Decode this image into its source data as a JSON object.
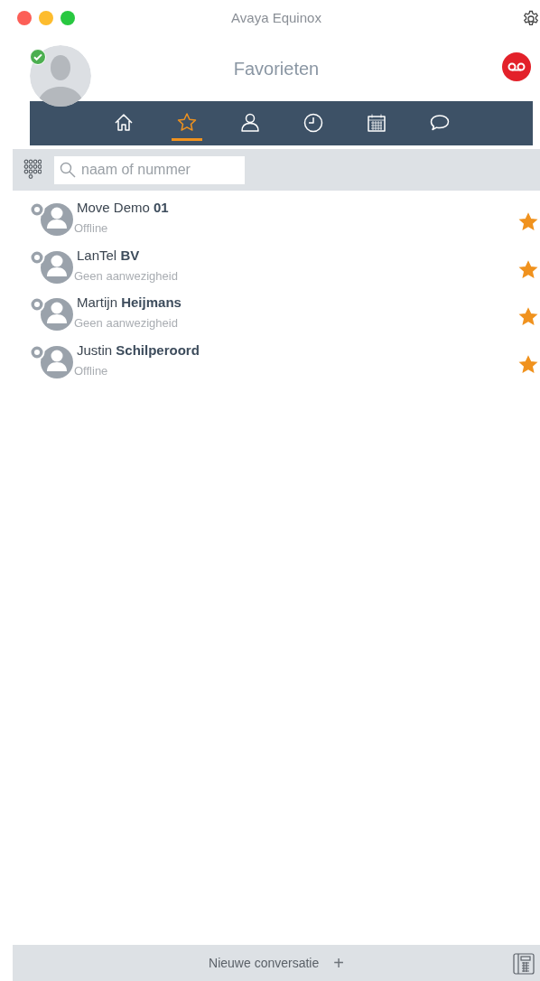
{
  "window": {
    "title": "Avaya Equinox"
  },
  "user": {
    "available": true
  },
  "header": {
    "title": "Favorieten",
    "voicemail": true
  },
  "tabs": [
    {
      "kind": "home",
      "selected": false
    },
    {
      "kind": "favorites",
      "selected": true
    },
    {
      "kind": "contacts",
      "selected": false
    },
    {
      "kind": "history",
      "selected": false
    },
    {
      "kind": "calendar",
      "selected": false
    },
    {
      "kind": "messages",
      "selected": false
    }
  ],
  "search": {
    "placeholder": "naam of nummer"
  },
  "contacts": [
    {
      "name": "Move Demo **01**",
      "status": "Offline",
      "favorite": true
    },
    {
      "name": "LanTel **BV**",
      "status": "Geen aanwezigheid",
      "favorite": true
    },
    {
      "name": "Martijn **Heijmans**",
      "status": "Geen aanwezigheid",
      "favorite": true
    },
    {
      "name": "Justin **Schilperoord**",
      "status": "Offline",
      "favorite": true
    }
  ],
  "footer": {
    "label": "Nieuwe conversatie",
    "plus": "+"
  }
}
